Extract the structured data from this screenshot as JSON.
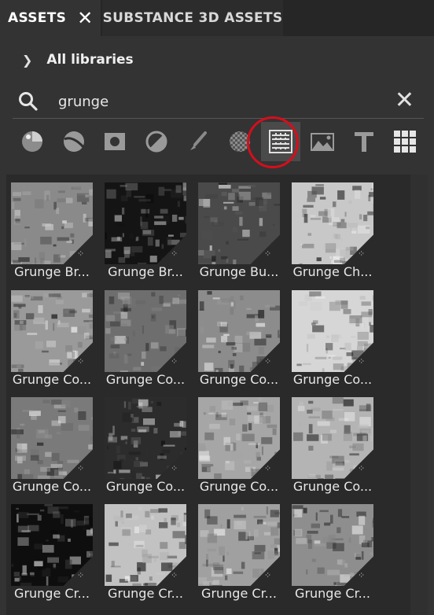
{
  "tabs": [
    {
      "label": "ASSETS"
    },
    {
      "label": "SUBSTANCE 3D ASSETS"
    }
  ],
  "breadcrumb": {
    "label": "All libraries"
  },
  "search": {
    "value": "grunge"
  },
  "filters": [
    {
      "icon": "material-ball-icon"
    },
    {
      "icon": "smart-material-icon"
    },
    {
      "icon": "mask-icon"
    },
    {
      "icon": "generator-icon"
    },
    {
      "icon": "brush-icon"
    },
    {
      "icon": "alpha-icon"
    },
    {
      "icon": "texture-pattern-icon",
      "active": true
    },
    {
      "icon": "environment-icon"
    },
    {
      "icon": "text-icon"
    },
    {
      "icon": "grid-icon"
    }
  ],
  "assets": [
    {
      "label": "Grunge Br...",
      "tone": "#8a8a8a"
    },
    {
      "label": "Grunge Br...",
      "tone": "#141414"
    },
    {
      "label": "Grunge Bu...",
      "tone": "#4a4a4a"
    },
    {
      "label": "Grunge Ch...",
      "tone": "#c8c8c8"
    },
    {
      "label": "Grunge Co...",
      "tone": "#9a9a9a"
    },
    {
      "label": "Grunge Co...",
      "tone": "#6e6e6e"
    },
    {
      "label": "Grunge Co...",
      "tone": "#8c8c8c"
    },
    {
      "label": "Grunge Co...",
      "tone": "#d6d6d6"
    },
    {
      "label": "Grunge Co...",
      "tone": "#7a7a7a"
    },
    {
      "label": "Grunge Co...",
      "tone": "#2c2c2c"
    },
    {
      "label": "Grunge Co...",
      "tone": "#a6a6a6"
    },
    {
      "label": "Grunge Co...",
      "tone": "#b4b4b4"
    },
    {
      "label": "Grunge Cr...",
      "tone": "#0e0e0e"
    },
    {
      "label": "Grunge Cr...",
      "tone": "#c2c2c2"
    },
    {
      "label": "Grunge Cr...",
      "tone": "#a0a0a0"
    },
    {
      "label": "Grunge Cr...",
      "tone": "#8e8e8e"
    }
  ],
  "colors": {
    "accent_circle": "#d60e1c"
  }
}
